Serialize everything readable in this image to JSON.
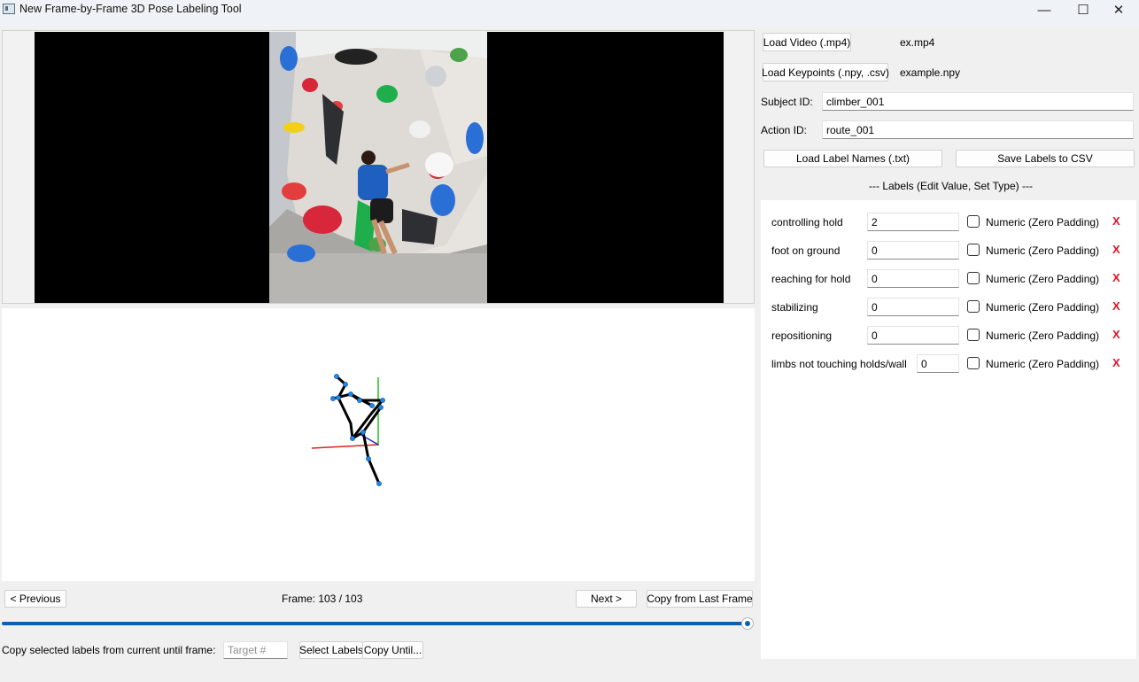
{
  "window": {
    "title": "New Frame-by-Frame 3D Pose Labeling Tool",
    "controls": {
      "minimize": "—",
      "maximize": "☐",
      "close": "✕"
    }
  },
  "files": {
    "load_video_label": "Load Video (.mp4)",
    "video_name": "ex.mp4",
    "load_keypoints_label": "Load Keypoints (.npy, .csv)",
    "keypoints_name": "example.npy"
  },
  "subject": {
    "label": "Subject ID:",
    "value": "climber_001"
  },
  "action": {
    "label": "Action ID:",
    "value": "route_001"
  },
  "buttons": {
    "load_label_names": "Load Label Names (.txt)",
    "save_labels": "Save Labels to CSV"
  },
  "labels_header": "--- Labels (Edit Value, Set Type) ---",
  "labels": [
    {
      "name": "controlling hold",
      "value": "2",
      "type_label": "Numeric (Zero Padding)",
      "numeric": false,
      "delete": "X"
    },
    {
      "name": "foot on ground",
      "value": "0",
      "type_label": "Numeric (Zero Padding)",
      "numeric": false,
      "delete": "X"
    },
    {
      "name": "reaching for hold",
      "value": "0",
      "type_label": "Numeric (Zero Padding)",
      "numeric": false,
      "delete": "X"
    },
    {
      "name": "stabilizing",
      "value": "0",
      "type_label": "Numeric (Zero Padding)",
      "numeric": false,
      "delete": "X"
    },
    {
      "name": "repositioning",
      "value": "0",
      "type_label": "Numeric (Zero Padding)",
      "numeric": false,
      "delete": "X"
    },
    {
      "name": "limbs not touching holds/wall",
      "value": "0",
      "type_label": "Numeric (Zero Padding)",
      "numeric": false,
      "delete": "X"
    }
  ],
  "navigation": {
    "previous": "< Previous",
    "frame_text": "Frame: 103 / 103",
    "next": "Next >",
    "copy_last": "Copy from Last Frame",
    "slider_fraction": 1.0
  },
  "copy_until": {
    "prompt": "Copy selected labels from current until frame:",
    "target_placeholder": "Target #",
    "select_labels": "Select Labels",
    "copy_until": "Copy Until..."
  },
  "colors": {
    "accent": "#0d5fb3",
    "delete": "#e81123",
    "axis_x": "#e02020",
    "axis_y": "#22c022",
    "axis_z": "#1a2db5",
    "joint": "#1e88e5"
  },
  "icons": [
    "app-icon",
    "minimize-icon",
    "maximize-icon",
    "close-icon"
  ]
}
